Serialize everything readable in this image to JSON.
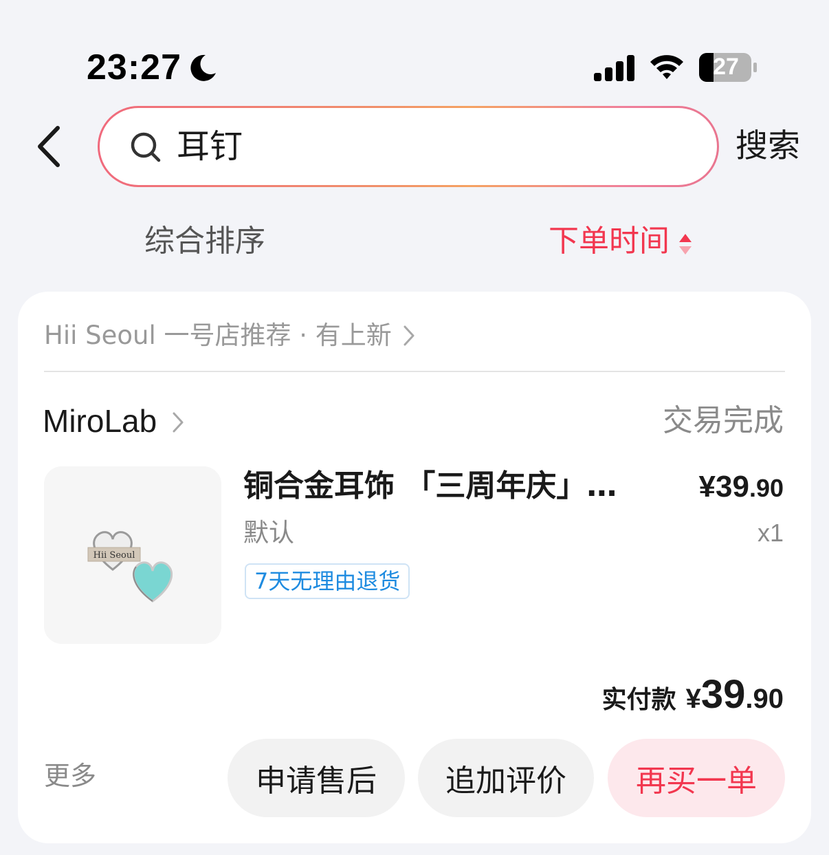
{
  "status_bar": {
    "time": "23:27",
    "battery": "27"
  },
  "search": {
    "query": "耳钉",
    "submit_label": "搜索"
  },
  "sort": {
    "default_label": "综合排序",
    "time_label": "下单时间"
  },
  "order": {
    "store_recommend": "Hii Seoul 一号店推荐 · 有上新",
    "shop_name": "MiroLab",
    "status": "交易完成",
    "product": {
      "title": "铜合金耳饰 「三周年庆」…",
      "price_int": "¥39",
      "price_dec": ".90",
      "variant": "默认",
      "quantity": "x1",
      "badge": "7天无理由退货",
      "image_logo_text": "Hii Seoul"
    },
    "paid": {
      "label": "实付款",
      "currency": "¥",
      "int": "39",
      "dec": ".90"
    },
    "actions": {
      "more": "更多",
      "after_sale": "申请售后",
      "add_review": "追加评价",
      "buy_again": "再买一单"
    }
  },
  "colors": {
    "accent": "#f2374f",
    "badge_blue": "#1e8be0",
    "background": "#f3f4f8"
  }
}
